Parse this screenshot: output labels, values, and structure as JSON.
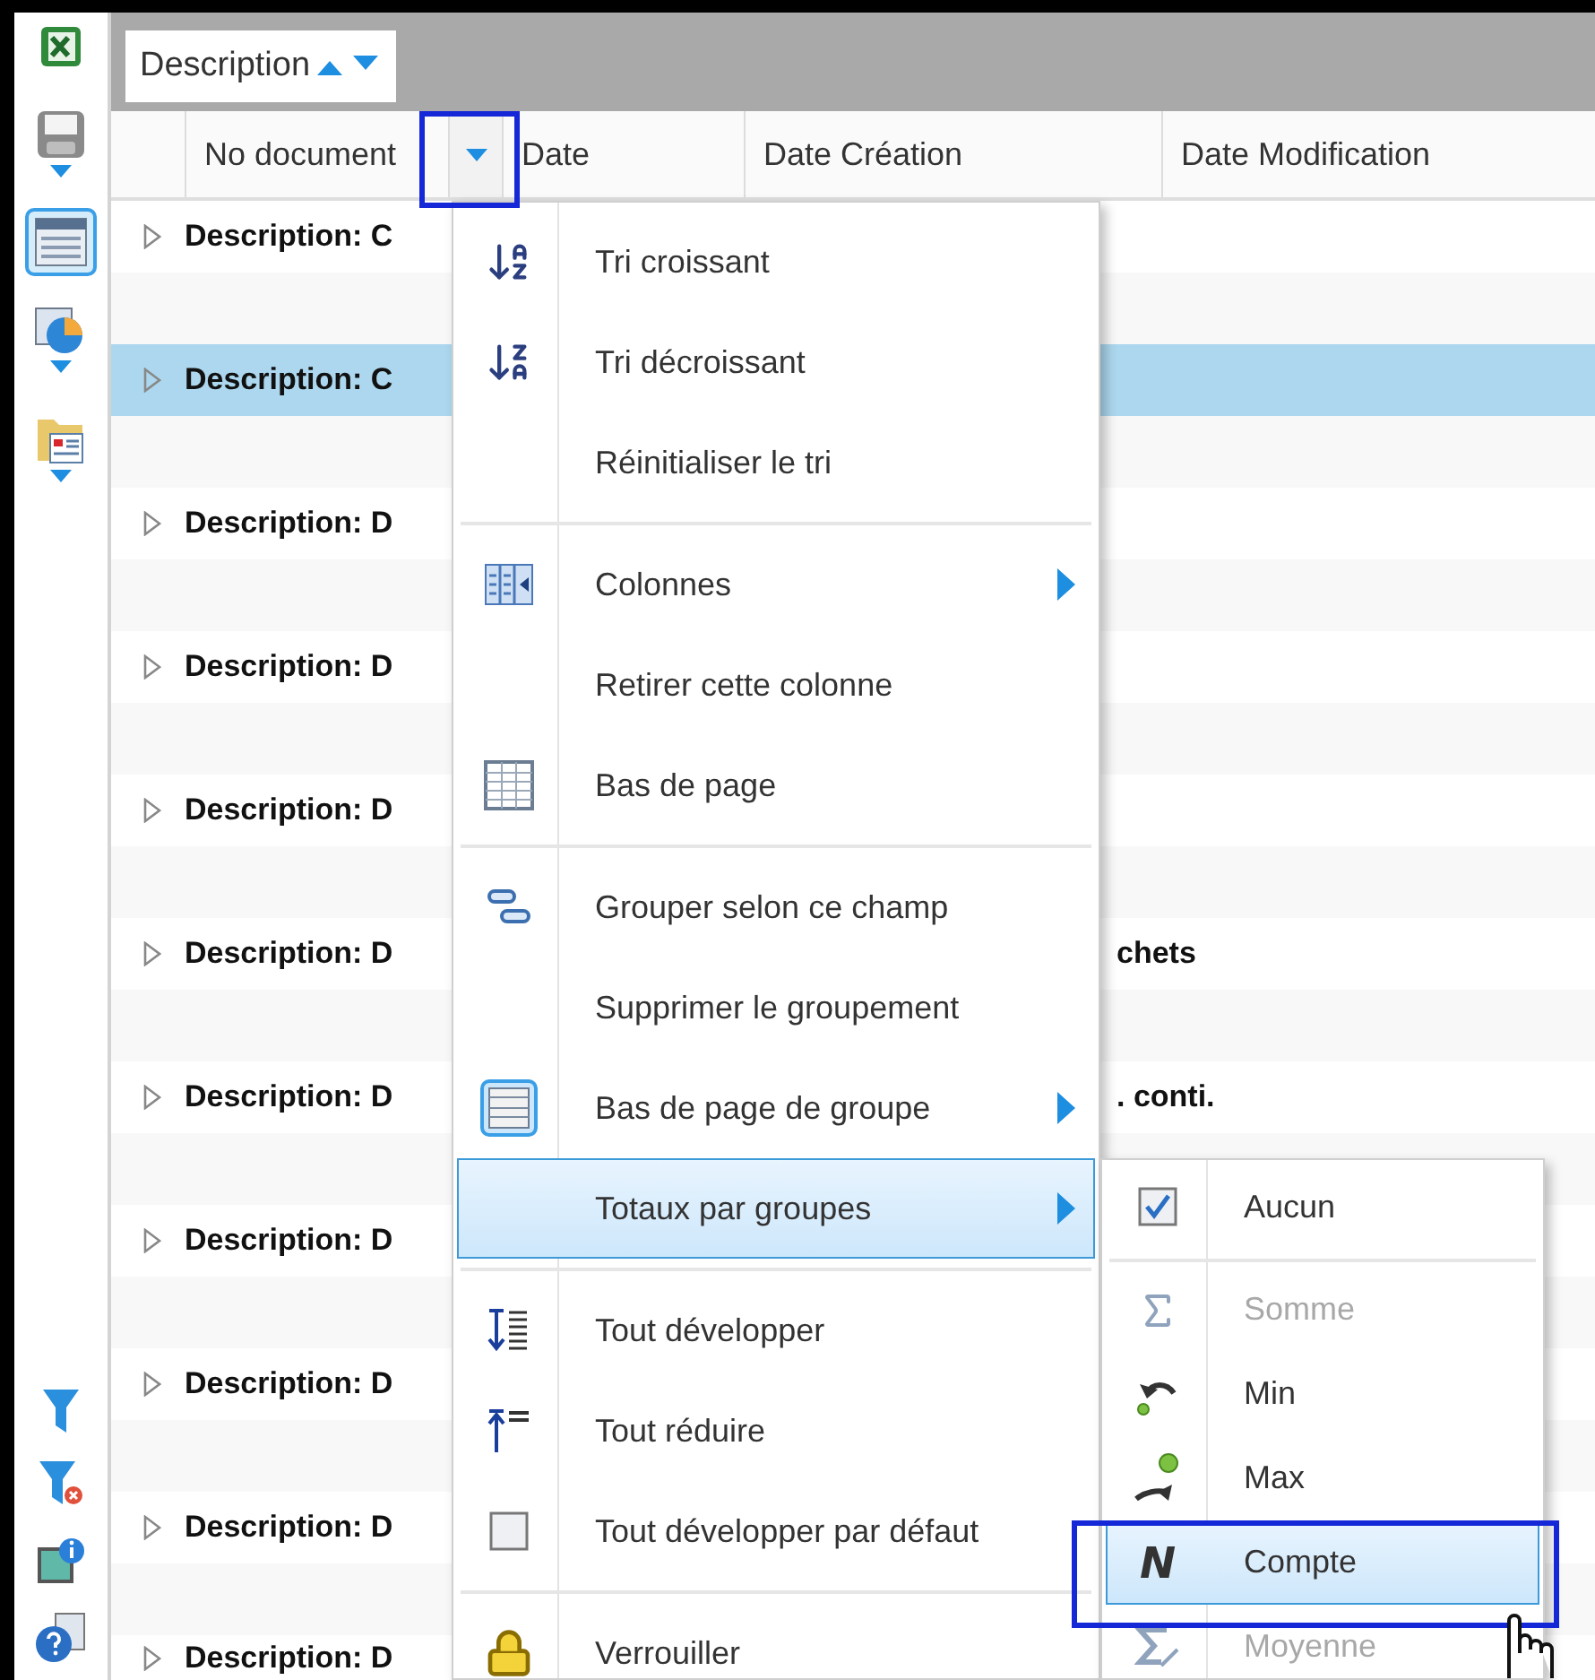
{
  "sidebar": {
    "top_tools": [
      {
        "kind": "excel",
        "selected": false,
        "dropdown": false
      },
      {
        "kind": "save",
        "selected": false,
        "dropdown": true
      },
      {
        "kind": "grid",
        "selected": true,
        "dropdown": false
      },
      {
        "kind": "chart",
        "selected": false,
        "dropdown": true
      },
      {
        "kind": "form",
        "selected": false,
        "dropdown": true
      }
    ],
    "bottom_tools": [
      {
        "kind": "filter"
      },
      {
        "kind": "clear-filter"
      },
      {
        "kind": "info"
      },
      {
        "kind": "help"
      }
    ]
  },
  "group_panel": {
    "chips": [
      {
        "label": "Description"
      }
    ]
  },
  "columns": [
    {
      "label": "No document",
      "menu_open": true
    },
    {
      "label": "Date",
      "menu_open": false
    },
    {
      "label": "Date Création",
      "menu_open": false
    },
    {
      "label": "Date Modification",
      "menu_open": false
    }
  ],
  "rows": [
    {
      "text": "Description: C",
      "selected": false
    },
    {
      "text": "Description: C",
      "selected": true
    },
    {
      "text": "Description: D",
      "selected": false
    },
    {
      "text": "Description: D",
      "selected": false
    },
    {
      "text": "Description: D",
      "selected": false
    },
    {
      "text": "Description: D",
      "trailing": "chets",
      "selected": false
    },
    {
      "text": "Description: D",
      "trailing": ". conti.",
      "selected": false
    },
    {
      "text": "Description: D",
      "selected": false
    },
    {
      "text": "Description: D",
      "selected": false
    },
    {
      "text": "Description: D",
      "selected": false
    },
    {
      "text": "Description: D",
      "selected": false
    }
  ],
  "context_menu": {
    "groups": [
      [
        {
          "kind": "command",
          "label": "Tri croissant",
          "submenu": false,
          "highlighted": false
        },
        {
          "kind": "command",
          "label": "Tri décroissant",
          "submenu": false,
          "highlighted": false
        },
        {
          "kind": "command",
          "label": "Réinitialiser le tri",
          "submenu": false,
          "highlighted": false
        }
      ],
      [
        {
          "kind": "command",
          "label": "Colonnes",
          "submenu": true,
          "highlighted": false
        },
        {
          "kind": "command",
          "label": "Retirer cette colonne",
          "submenu": false,
          "highlighted": false
        },
        {
          "kind": "command",
          "label": "Bas de page",
          "submenu": false,
          "highlighted": false
        }
      ],
      [
        {
          "kind": "command",
          "label": "Grouper selon ce champ",
          "submenu": false,
          "highlighted": false
        },
        {
          "kind": "command",
          "label": "Supprimer le groupement",
          "submenu": false,
          "highlighted": false
        },
        {
          "kind": "command",
          "label": "Bas de page de groupe",
          "submenu": true,
          "highlighted": false
        },
        {
          "kind": "command",
          "label": "Totaux par groupes",
          "submenu": true,
          "highlighted": true
        }
      ],
      [
        {
          "kind": "command",
          "label": "Tout développer",
          "submenu": false,
          "highlighted": false
        },
        {
          "kind": "command",
          "label": "Tout réduire",
          "submenu": false,
          "highlighted": false
        },
        {
          "kind": "check",
          "label": "Tout développer par défaut",
          "checked": false,
          "submenu": false,
          "highlighted": false
        }
      ],
      [
        {
          "kind": "command",
          "label": "Verrouiller",
          "submenu": false,
          "highlighted": false
        }
      ]
    ]
  },
  "submenu": {
    "groups": [
      [
        {
          "kind": "check",
          "label": "Aucun",
          "checked": true,
          "disabled": false,
          "highlighted": false
        }
      ],
      [
        {
          "kind": "command",
          "label": "Somme",
          "disabled": true,
          "highlighted": false
        },
        {
          "kind": "command",
          "label": "Min",
          "disabled": false,
          "highlighted": false
        },
        {
          "kind": "command",
          "label": "Max",
          "disabled": false,
          "highlighted": false
        },
        {
          "kind": "command",
          "label": "Compte",
          "glyph": "N",
          "disabled": false,
          "highlighted": true
        },
        {
          "kind": "command",
          "label": "Moyenne",
          "disabled": true,
          "highlighted": false
        }
      ]
    ]
  }
}
